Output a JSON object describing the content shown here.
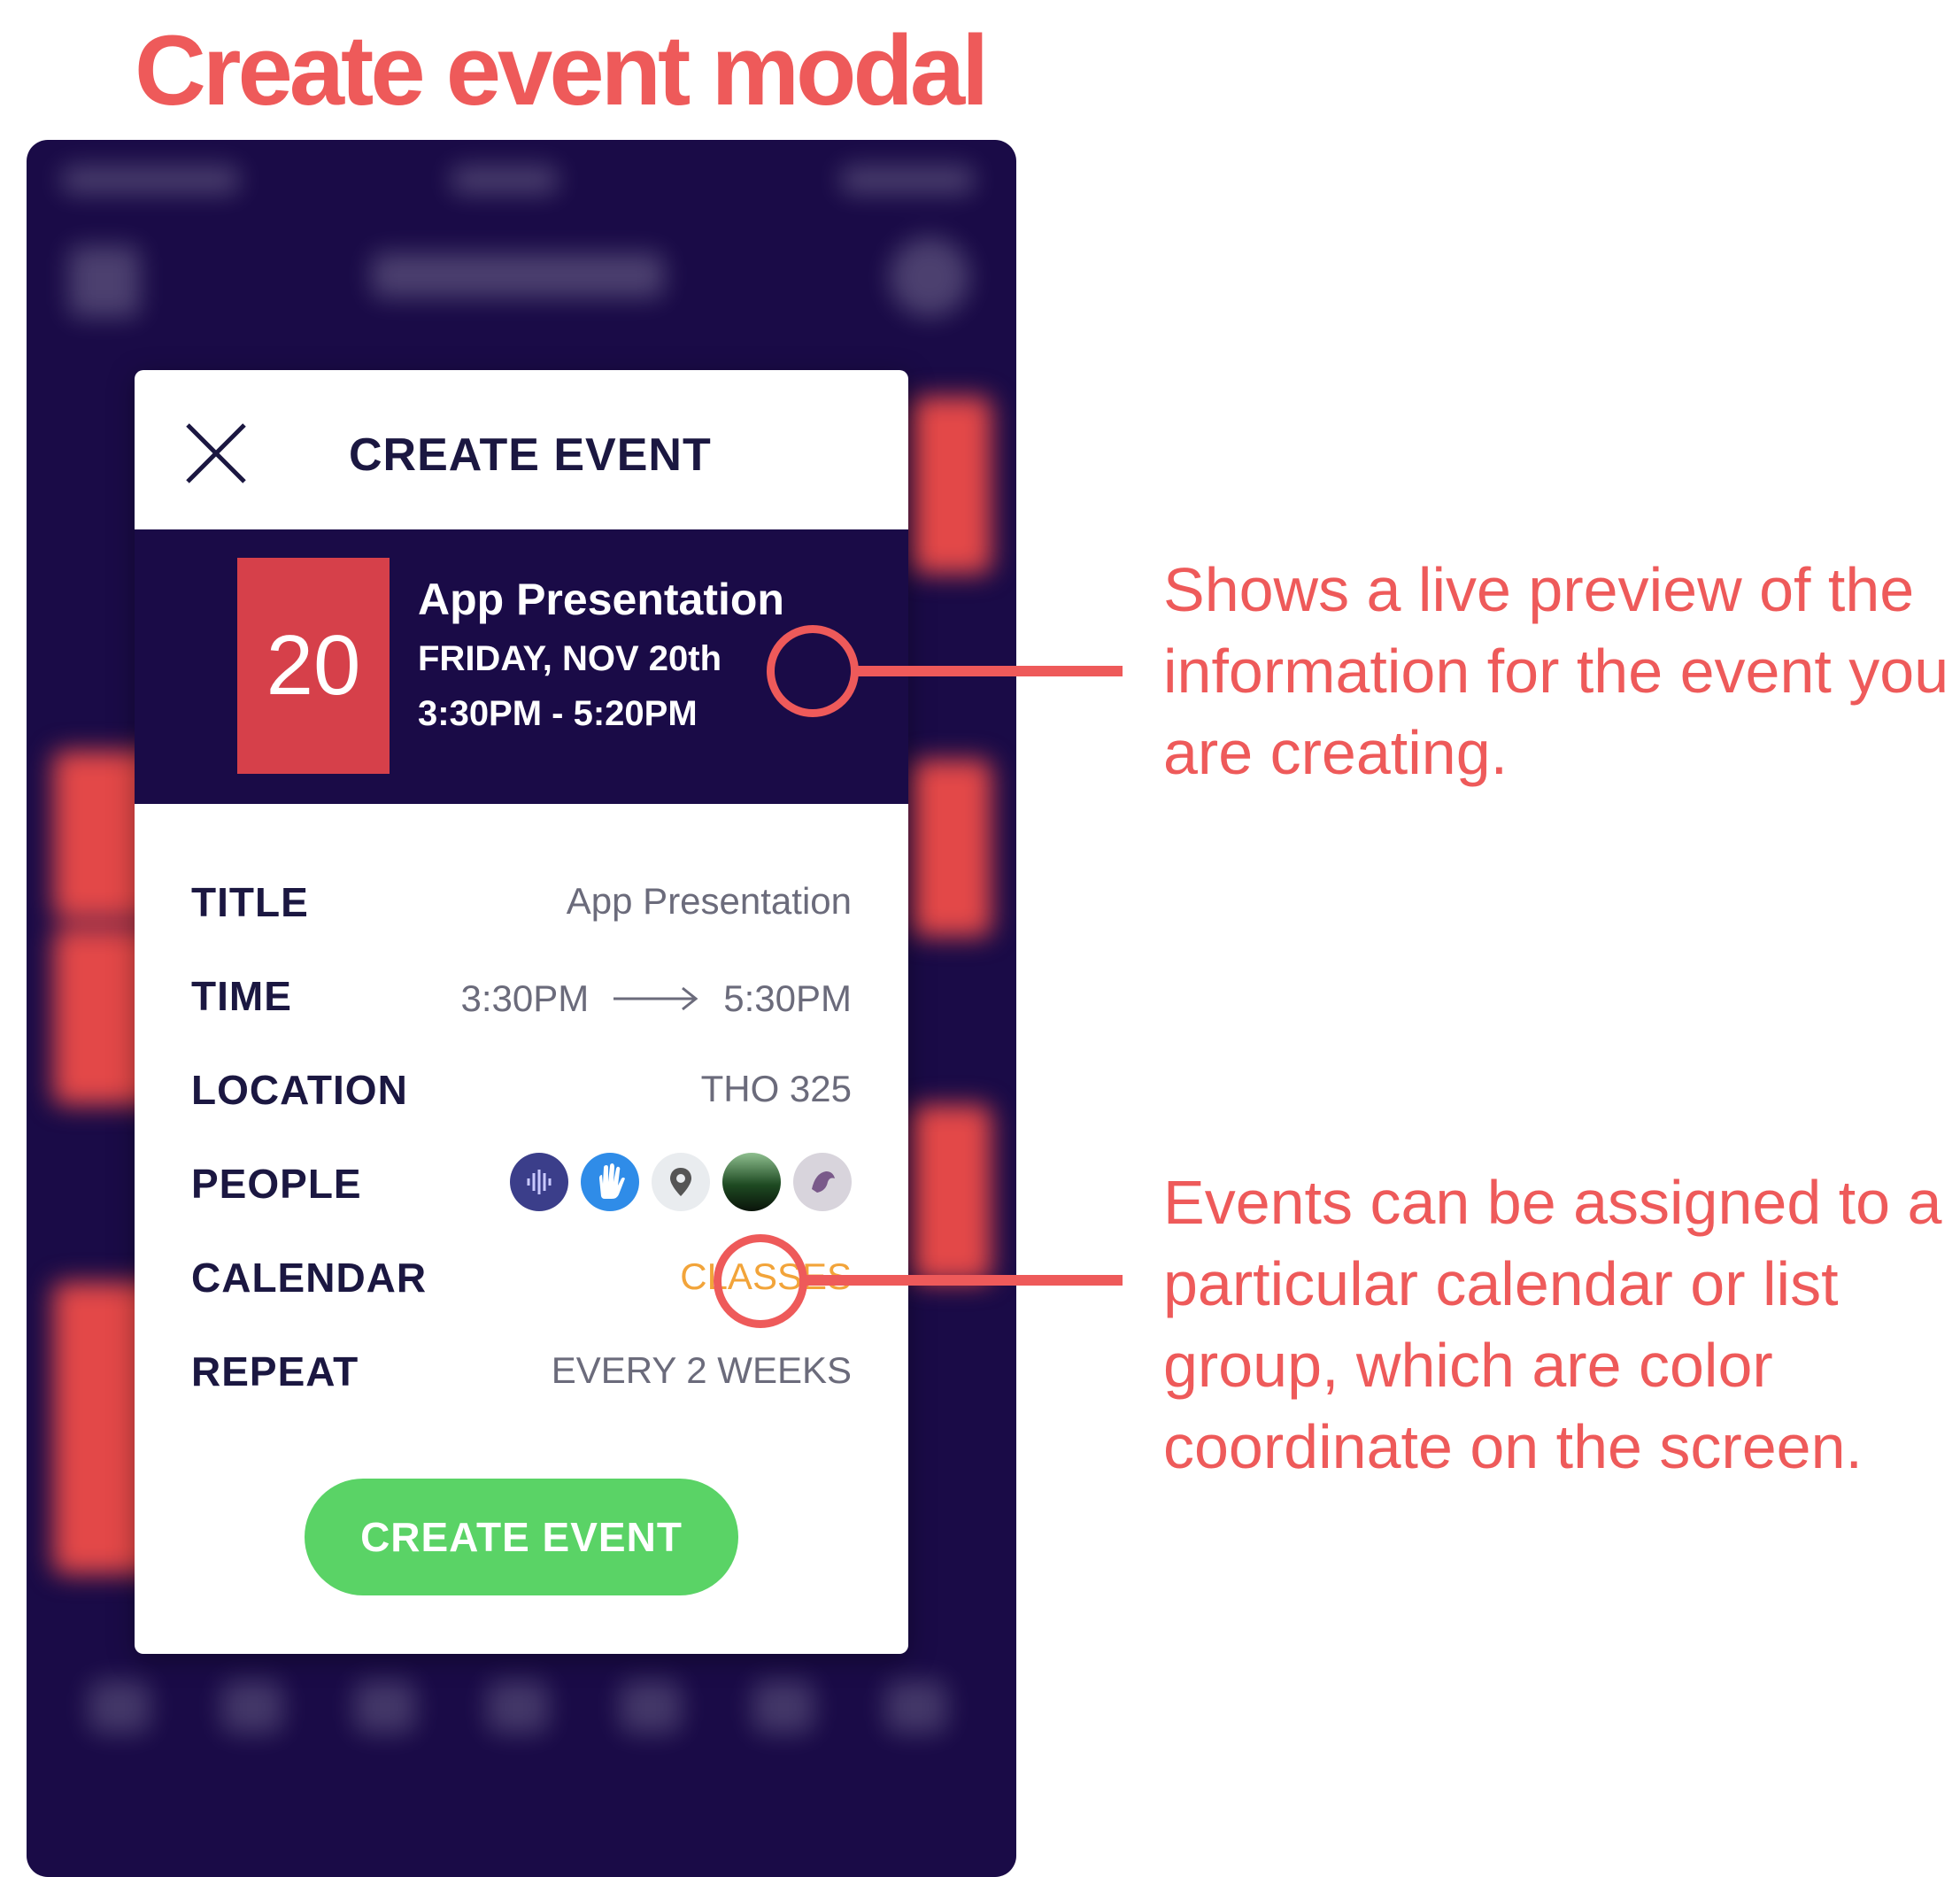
{
  "page": {
    "heading": "Create event modal"
  },
  "modal": {
    "title": "CREATE EVENT",
    "preview": {
      "day": "20",
      "title": "App Presentation",
      "date": "FRIDAY, NOV 20th",
      "time": "3:30PM - 5:20PM"
    },
    "fields": {
      "title": {
        "label": "TITLE",
        "value": "App Presentation"
      },
      "time": {
        "label": "TIME",
        "start": "3:30PM",
        "end": "5:30PM"
      },
      "location": {
        "label": "LOCATION",
        "value": "THO 325"
      },
      "people": {
        "label": "PEOPLE"
      },
      "calendar": {
        "label": "CALENDAR",
        "value": "CLASSES",
        "color": "#f2a43a"
      },
      "repeat": {
        "label": "REPEAT",
        "value": "EVERY 2 WEEKS"
      }
    },
    "submit_label": "CREATE EVENT",
    "submit_color": "#5ad366",
    "accent_color": "#d6404a",
    "background_color": "#1a0b47"
  },
  "annotations": {
    "preview_note": "Shows a live preview of the information for the event you are creating.",
    "calendar_note": "Events can be assigned to a particular calendar or list group, which are color coordinate on the screen.",
    "color": "#ee5a5a"
  }
}
